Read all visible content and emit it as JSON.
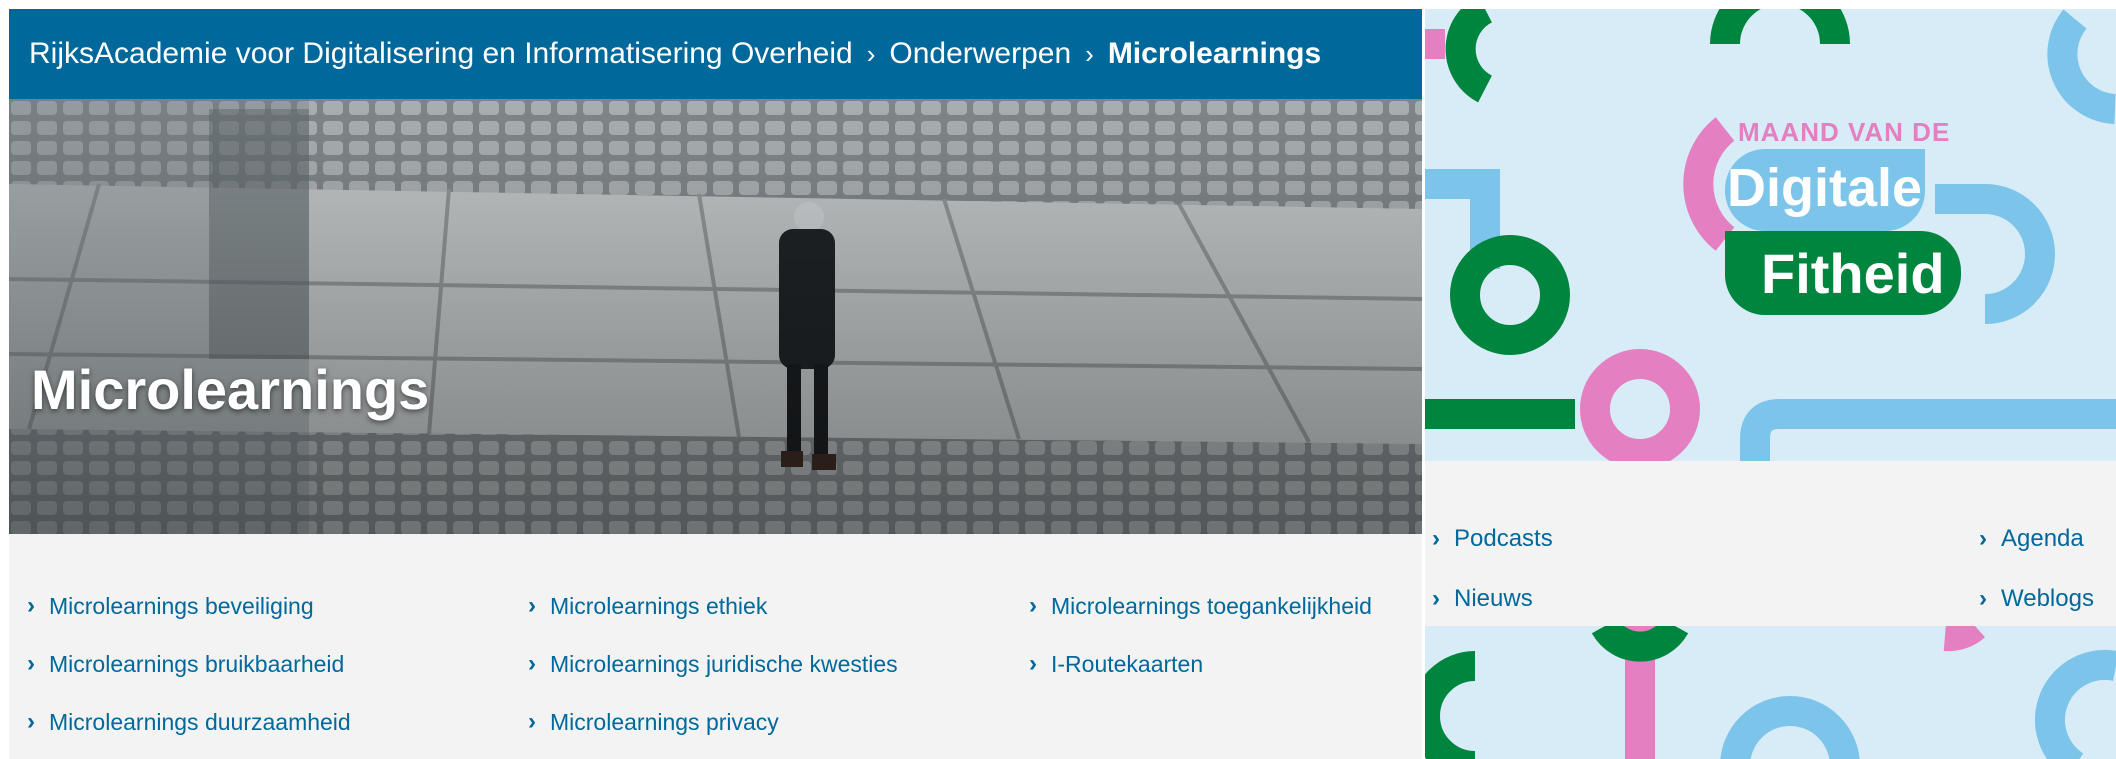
{
  "breadcrumb": {
    "root": "RijksAcademie voor Digitalisering en Informatisering Overheid",
    "parent": "Onderwerpen",
    "current": "Microlearnings",
    "separator": "›"
  },
  "hero": {
    "title": "Microlearnings"
  },
  "topic_links": [
    {
      "label": "Microlearnings beveiliging"
    },
    {
      "label": "Microlearnings bruikbaarheid"
    },
    {
      "label": "Microlearnings duurzaamheid"
    },
    {
      "label": "Microlearnings ethiek"
    },
    {
      "label": "Microlearnings juridische kwesties"
    },
    {
      "label": "Microlearnings privacy"
    },
    {
      "label": "Microlearnings toegankelijkheid"
    },
    {
      "label": "I-Routekaarten"
    }
  ],
  "promo": {
    "line1": "MAAND VAN DE",
    "line2": "Digitale",
    "line3": "Fitheid"
  },
  "quick_links": [
    {
      "label": "Podcasts"
    },
    {
      "label": "Agenda"
    },
    {
      "label": "Nieuws"
    },
    {
      "label": "Weblogs"
    }
  ],
  "colors": {
    "brand_blue": "#01689b",
    "link_blue": "#01689b",
    "panel_grey": "#f3f3f3",
    "promo_green": "#00853e",
    "promo_pink": "#e47fc1",
    "promo_lightblue": "#7cc4ea",
    "promo_bg": "#d7ecf6"
  },
  "icons": {
    "link_chevron": "chevron-right-icon",
    "breadcrumb_separator": "chevron-right-icon"
  }
}
